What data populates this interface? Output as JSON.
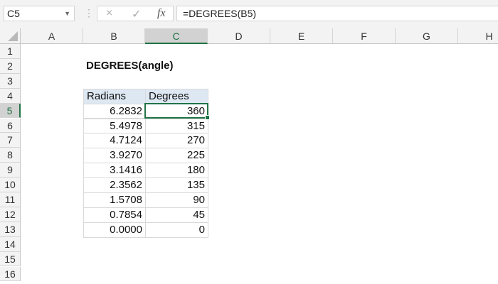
{
  "name_box": "C5",
  "formula_bar": "=DEGREES(B5)",
  "icons": {
    "cancel": "×",
    "enter": "✓",
    "fx": "fx"
  },
  "columns": [
    "A",
    "B",
    "C",
    "D",
    "E",
    "F",
    "G",
    "H"
  ],
  "rows": [
    "1",
    "2",
    "3",
    "4",
    "5",
    "6",
    "7",
    "8",
    "9",
    "10",
    "11",
    "12",
    "13",
    "14",
    "15",
    "16"
  ],
  "title": "DEGREES(angle)",
  "table": {
    "headers": [
      "Radians",
      "Degrees"
    ],
    "rows": [
      [
        "6.2832",
        "360"
      ],
      [
        "5.4978",
        "315"
      ],
      [
        "4.7124",
        "270"
      ],
      [
        "3.9270",
        "225"
      ],
      [
        "3.1416",
        "180"
      ],
      [
        "2.3562",
        "135"
      ],
      [
        "1.5708",
        "90"
      ],
      [
        "0.7854",
        "45"
      ],
      [
        "0.0000",
        "0"
      ]
    ]
  },
  "selected_cell": "C5",
  "accent_color": "#217346"
}
